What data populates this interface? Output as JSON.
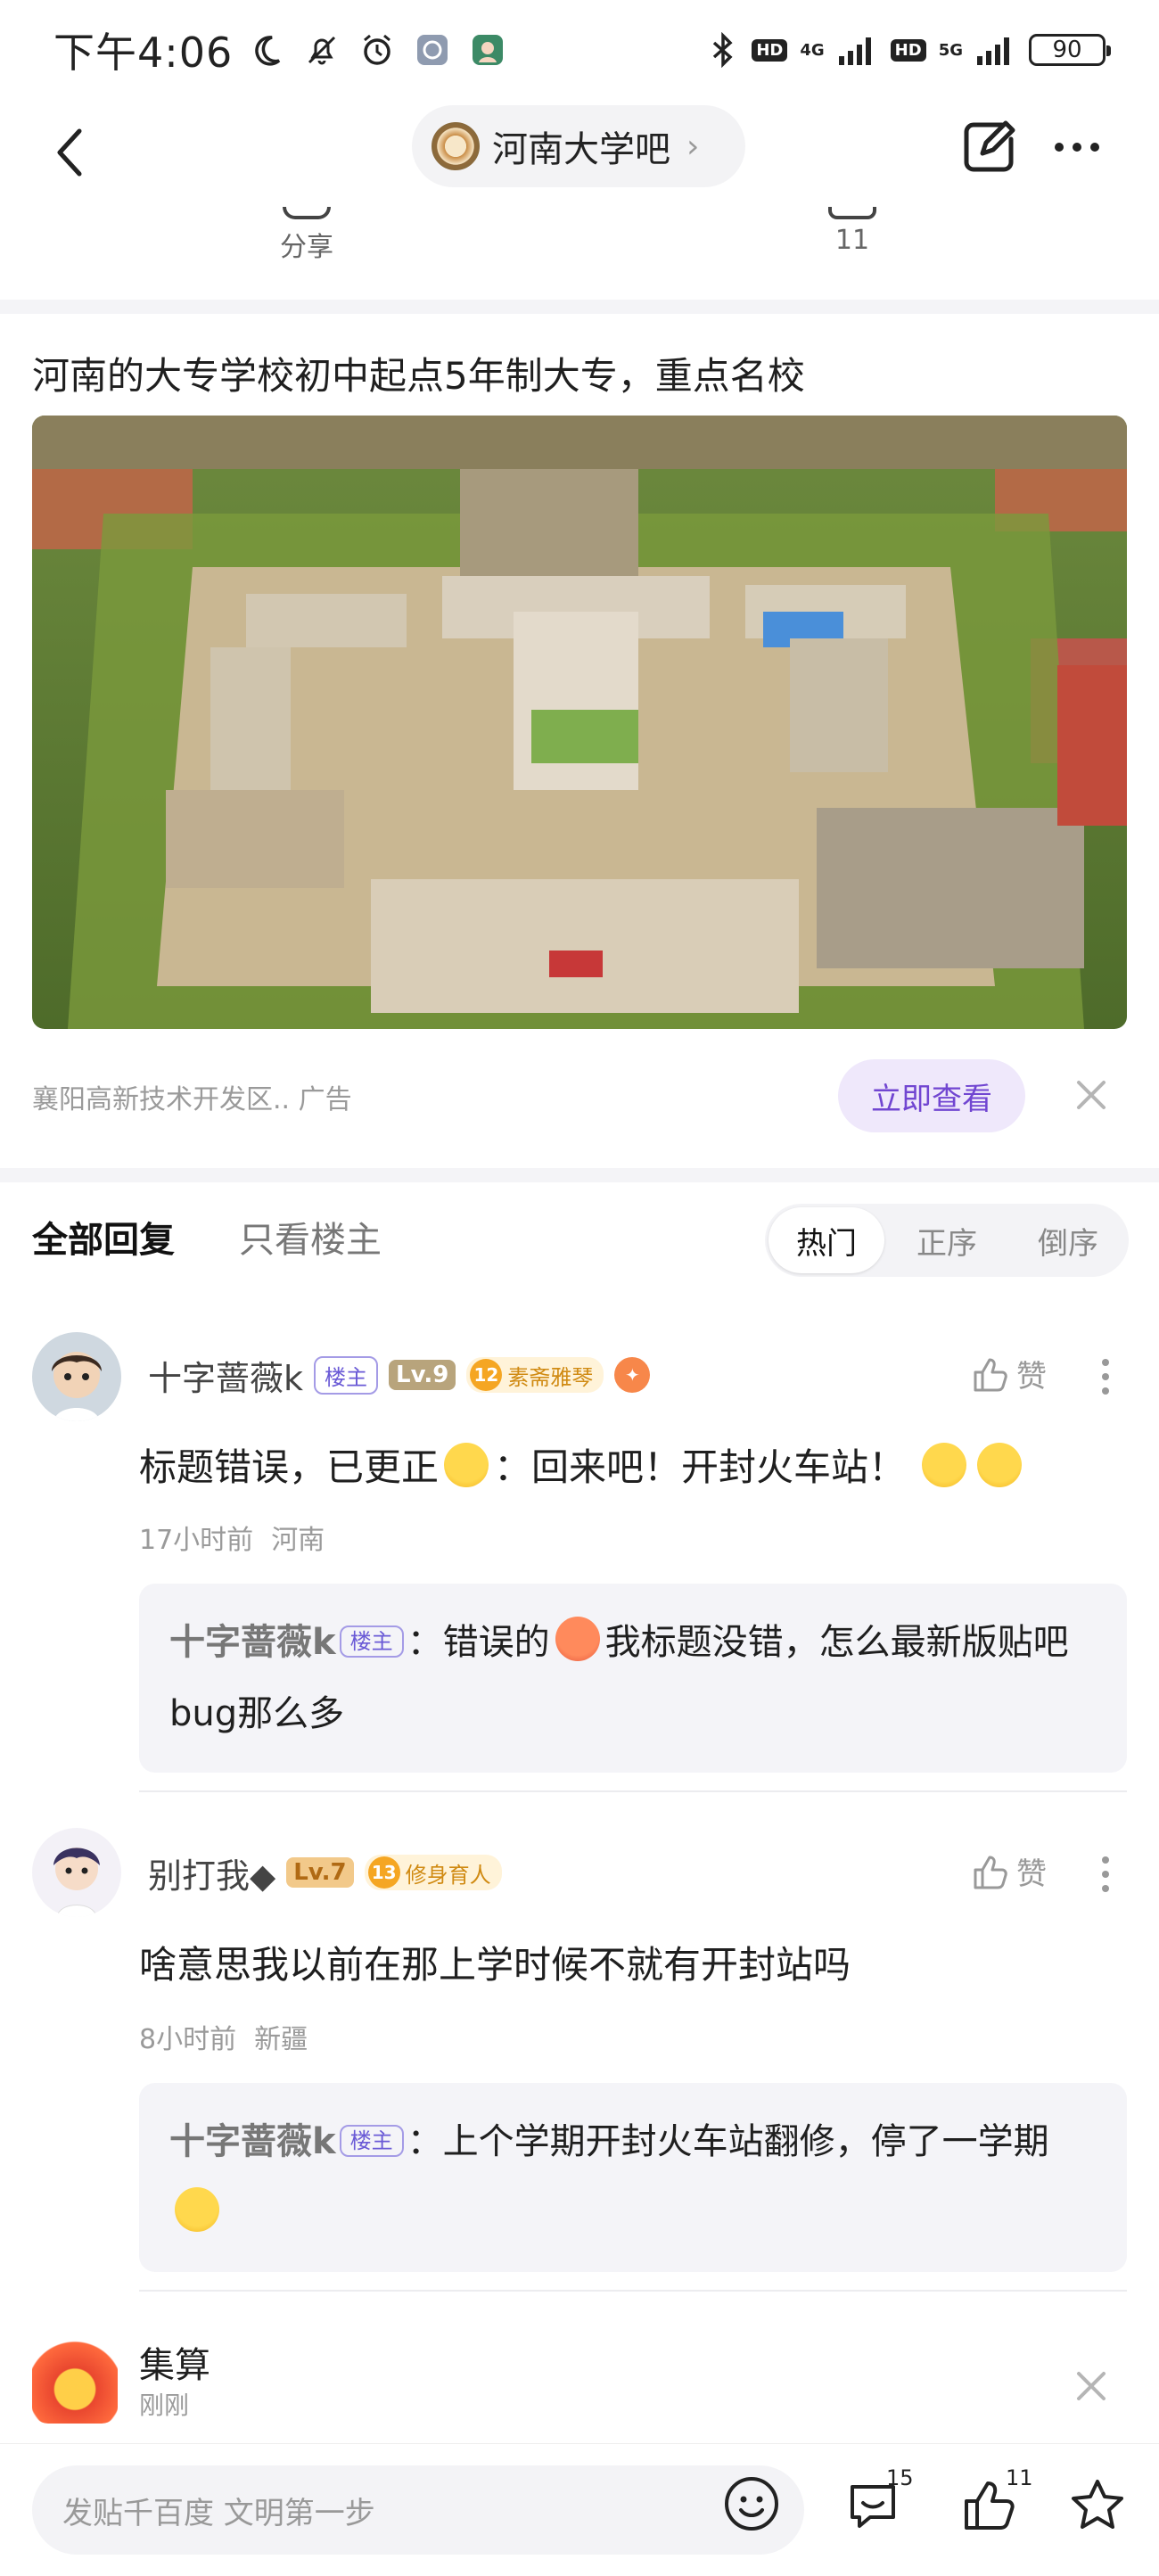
{
  "status_bar": {
    "time": "下午4:06",
    "net1": "4G",
    "net2": "5G",
    "hd": "HD",
    "battery": "90"
  },
  "header": {
    "forum_name": "河南大学吧",
    "chevron": "›"
  },
  "share_row": {
    "share_label": "分享",
    "count": "11"
  },
  "ad": {
    "title": "河南的大专学校初中起点5年制大专，重点名校",
    "source": "襄阳高新技术开发区..  广告",
    "cta": "立即查看"
  },
  "reply_tabs": {
    "all": "全部回复",
    "owner_only": "只看楼主",
    "sort": [
      "热门",
      "正序",
      "倒序"
    ]
  },
  "comments": [
    {
      "name": "十字蔷薇k",
      "owner_tag": "楼主",
      "level": "Lv.9",
      "honor_num": "12",
      "honor": "素斋雅琴",
      "like_label": "赞",
      "text_a": "标题错误，已更正",
      "text_b": "：回来吧！开封火车站！",
      "time": "17小时前",
      "location": "河南",
      "reply": {
        "name": "十字蔷薇k",
        "owner_tag": "楼主",
        "text_a": "：错误的",
        "text_b": "我标题没错，怎么最新版贴吧bug那么多"
      }
    },
    {
      "name": "别打我◆",
      "level": "Lv.7",
      "honor_num": "13",
      "honor": "修身育人",
      "like_label": "赞",
      "text": "啥意思我以前在那上学时候不就有开封站吗",
      "time": "8小时前",
      "location": "新疆",
      "reply": {
        "name": "十字蔷薇k",
        "owner_tag": "楼主",
        "text_a": "：上个学期开封火车站翻修，停了一学期"
      }
    }
  ],
  "notification": {
    "title": "集算",
    "time": "刚刚"
  },
  "bottom_bar": {
    "input_placeholder": "发贴千百度 文明第一步",
    "comment_count": "15",
    "like_count": "11"
  }
}
